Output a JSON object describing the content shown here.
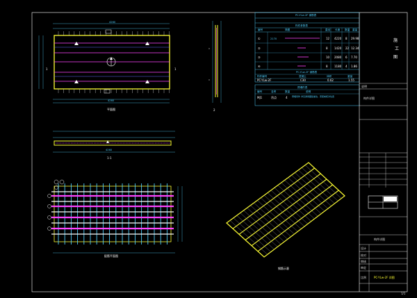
{
  "drawing": {
    "views": {
      "plan": "平面图",
      "bottom": "配筋平面图",
      "iso": "钢筋示意"
    },
    "dims": {
      "total": "4260",
      "left": "140",
      "height": "1460",
      "side": "360",
      "section": "1-1",
      "marker": "1",
      "marker2": "2"
    },
    "table1": {
      "title": "PC-YLw-2F 钢筋表",
      "header": [
        "编号",
        "简图",
        "直径",
        "长度",
        "数量",
        "重量"
      ],
      "rows": [
        [
          "①",
          "2170",
          "12",
          "4220",
          "8",
          "29.98"
        ],
        [
          "②",
          "",
          "8",
          "1420",
          "22",
          "12.34"
        ],
        [
          "③",
          "",
          "10",
          "2080",
          "6",
          "7.70"
        ],
        [
          "④",
          "",
          "8",
          "1180",
          "4",
          "1.86"
        ]
      ]
    },
    "table2": {
      "title": "构件参数表",
      "header": [
        "构件编号",
        "混凝土",
        "体积",
        "重量"
      ],
      "rows": [
        [
          "PC-YLw-2F",
          "C30",
          "0.62",
          "1.55"
        ]
      ]
    },
    "table3": {
      "title": "预埋件表",
      "header": [
        "编号",
        "名称",
        "数量",
        "说明"
      ],
      "rows": [
        [
          "MJ1",
          "吊点",
          "4",
          "预埋吊件 详见通用图集做法，安装前核对位置"
        ]
      ]
    },
    "notes_title": "说明",
    "notes_side": [
      "施",
      "工",
      "图"
    ],
    "titleblock": {
      "labels": [
        "设计",
        "校对",
        "审核",
        "审定",
        "项目负责",
        "专业负责",
        "日期",
        "比例"
      ],
      "project": "构件详图",
      "sheet": "PC-YLw-2F 详图",
      "page": "1/1"
    }
  },
  "colors": {
    "frame": "#ffffff",
    "slab": "#ffff33",
    "rebar": "#ff44ff",
    "rebar2": "#4fd0ff",
    "dim": "#4fd0ff",
    "green": "#00ff66",
    "grey": "#aaaaaa"
  }
}
